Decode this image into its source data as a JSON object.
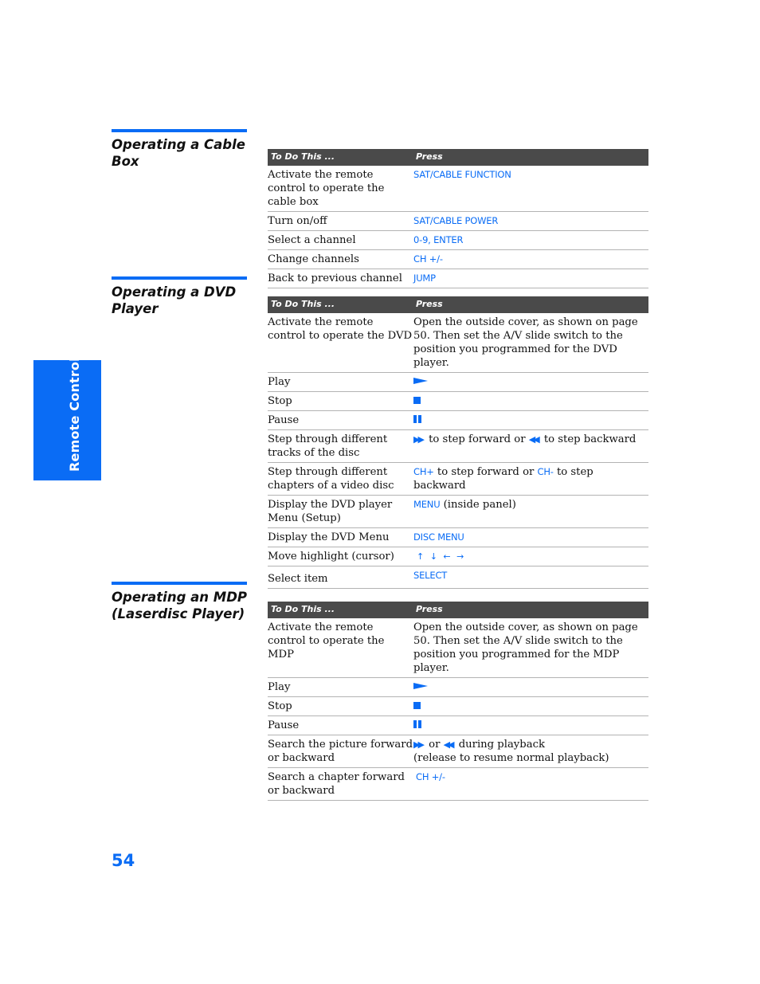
{
  "side_tab": {
    "label": "Remote Control"
  },
  "page_number": "54",
  "header": {
    "col1": "To Do This ...",
    "col2": "Press"
  },
  "sections": [
    {
      "title": "Operating a Cable Box",
      "rows": [
        {
          "action": "Activate the remote control to operate the cable box",
          "press": "SAT/CABLE FUNCTION"
        },
        {
          "action": "Turn on/off",
          "press": "SAT/CABLE POWER"
        },
        {
          "action": "Select a channel",
          "press": "0-9, ENTER"
        },
        {
          "action": "Change channels",
          "press": "CH +/-"
        },
        {
          "action": "Back to previous channel",
          "press": "JUMP"
        }
      ]
    },
    {
      "title": "Operating a DVD Player",
      "rows": [
        {
          "action": "Activate the remote control to operate the DVD",
          "press_text": "Open the outside cover, as shown on page 50. Then set the A/V slide switch to the position you programmed for the DVD player."
        },
        {
          "action": "Play",
          "icon": "play-icon"
        },
        {
          "action": "Stop",
          "icon": "stop-icon"
        },
        {
          "action": "Pause",
          "icon": "pause-icon"
        },
        {
          "action": "Step through different tracks of the disc",
          "fwd_text": "to step forward or",
          "back_text": "to step backward"
        },
        {
          "action": "Step through different chapters of a video disc",
          "key1": "CH+",
          "mid_text": "to step forward or",
          "key2": "CH-",
          "end_text": "to step backward"
        },
        {
          "action": "Display the DVD player Menu (Setup)",
          "press": "MENU",
          "suffix": "(inside panel)"
        },
        {
          "action": "Display the DVD Menu",
          "press": "DISC MENU"
        },
        {
          "action": "Move highlight (cursor)",
          "arrows": "↑ ↓ ← →"
        },
        {
          "action": "Select item",
          "press": "SELECT"
        }
      ]
    },
    {
      "title": "Operating an MDP (Laserdisc Player)",
      "rows": [
        {
          "action": "Activate the remote control to operate the MDP",
          "press_text": "Open the outside cover, as shown on page 50. Then set the A/V slide switch to the position you programmed for the MDP player."
        },
        {
          "action": "Play",
          "icon": "play-icon"
        },
        {
          "action": "Stop",
          "icon": "stop-icon"
        },
        {
          "action": "Pause",
          "icon": "pause-icon"
        },
        {
          "action": "Search the picture forward or backward",
          "mid_text": "or",
          "end_text": "during playback",
          "note": "(release to resume normal playback)"
        },
        {
          "action": "Search a chapter forward or backward",
          "press": "CH +/-"
        }
      ]
    }
  ],
  "colors": {
    "accent": "#0a6cf5",
    "header_bg": "#4a4a4a",
    "rule": "#b3b3b3"
  }
}
